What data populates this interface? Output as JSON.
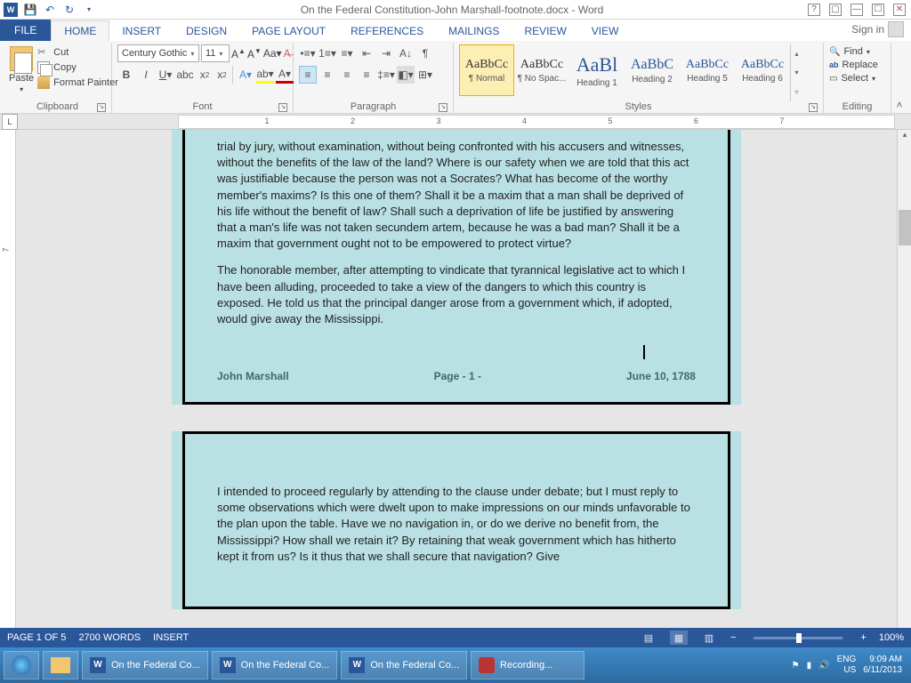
{
  "titlebar": {
    "title": "On the Federal Constitution-John Marshall-footnote.docx - Word"
  },
  "tabs": {
    "file": "FILE",
    "items": [
      "HOME",
      "INSERT",
      "DESIGN",
      "PAGE LAYOUT",
      "REFERENCES",
      "MAILINGS",
      "REVIEW",
      "VIEW"
    ],
    "active": "HOME",
    "signin": "Sign in"
  },
  "clipboard": {
    "paste": "Paste",
    "cut": "Cut",
    "copy": "Copy",
    "format_painter": "Format Painter",
    "group": "Clipboard"
  },
  "font": {
    "name": "Century Gothic",
    "size": "11",
    "group": "Font"
  },
  "paragraph": {
    "group": "Paragraph"
  },
  "styles": {
    "group": "Styles",
    "items": [
      {
        "preview": "AaBbCc",
        "name": "¶ Normal",
        "size": "14px",
        "color": "#333"
      },
      {
        "preview": "AaBbCc",
        "name": "¶ No Spac...",
        "size": "14px",
        "color": "#333"
      },
      {
        "preview": "AaBl",
        "name": "Heading 1",
        "size": "22px",
        "color": "#2a579a"
      },
      {
        "preview": "AaBbC",
        "name": "Heading 2",
        "size": "16px",
        "color": "#2a579a"
      },
      {
        "preview": "AaBbCc",
        "name": "Heading 5",
        "size": "14px",
        "color": "#2a579a"
      },
      {
        "preview": "AaBbCc",
        "name": "Heading 6",
        "size": "14px",
        "color": "#2a579a"
      }
    ]
  },
  "editing": {
    "find": "Find",
    "replace": "Replace",
    "select": "Select",
    "group": "Editing"
  },
  "ruler": {
    "marks": [
      "1",
      "2",
      "3",
      "4",
      "5",
      "6",
      "7"
    ]
  },
  "document": {
    "p1": "trial by jury, without examination, without being confronted with his accusers and witnesses, without the benefits of the law of the land? Where is our safety when we are told that this act was justifiable because the person was not a Socrates? What has become of the worthy member's maxims? Is this one of them? Shall it be a maxim that a man shall be deprived of his life without the benefit of law? Shall such a deprivation of life be justified by answering that a man's life was not taken secundem artem, because he was a bad man? Shall it be a maxim that government ought not to be empowered to protect virtue?",
    "p2": "The honorable member, after attempting to vindicate that tyrannical legislative act to which I have been alluding, proceeded to take a view of the dangers to which this country is exposed. He told us that the principal danger arose from a government which, if adopted, would give away the Mississippi.",
    "p3": "I intended to proceed regularly by attending to the clause under debate; but I must reply to some observations which were dwelt upon to make impressions on our minds unfavorable to the plan upon the table. Have we no navigation in, or do we derive no benefit from, the Mississippi? How shall we retain it? By retaining that weak government which has hitherto kept it from us? Is it thus that we shall secure that navigation? Give",
    "footer": {
      "author": "John Marshall",
      "page": "Page - 1 -",
      "date": "June 10, 1788"
    }
  },
  "status": {
    "page": "PAGE 1 OF 5",
    "words": "2700 WORDS",
    "mode": "INSERT",
    "zoom": "100%"
  },
  "taskbar": {
    "items": [
      "On the Federal Co...",
      "On the Federal Co...",
      "On the Federal Co...",
      "Recording..."
    ],
    "lang": "ENG",
    "region": "US",
    "time": "9:09 AM",
    "date": "6/11/2013"
  }
}
